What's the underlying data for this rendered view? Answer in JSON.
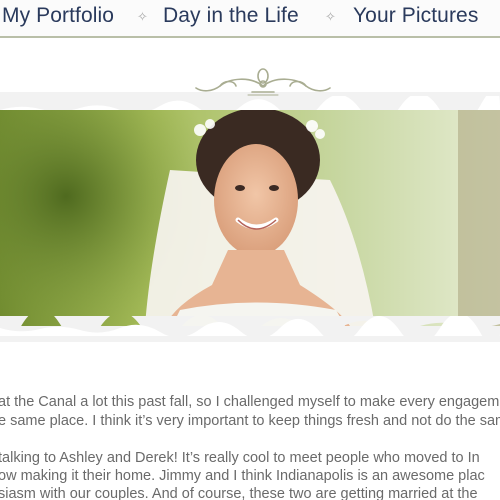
{
  "nav": {
    "items": [
      {
        "label": "My Portfolio"
      },
      {
        "label": "Day in the Life"
      },
      {
        "label": "Your Pictures"
      }
    ],
    "separator": "✧"
  },
  "hero": {
    "icon": "bride-photo",
    "alt": "bride in veil smiling outdoors"
  },
  "article": {
    "lines": [
      "at the Canal a lot this past fall, so I challenged myself to make every engagem",
      "e same place. I think it’s very important to keep things fresh and not do the sam",
      " talking to Ashley and Derek! It’s really cool to meet people who moved to In",
      "ow making it their home. Jimmy and I think Indianapolis is an awesome plac",
      "siasm with our couples. And of course, these two are getting married at the"
    ]
  },
  "colors": {
    "nav_text": "#2a3a5c",
    "rule": "#b9bfa8",
    "body_text": "#6a6a6a",
    "frame": "#f2f2f2"
  }
}
